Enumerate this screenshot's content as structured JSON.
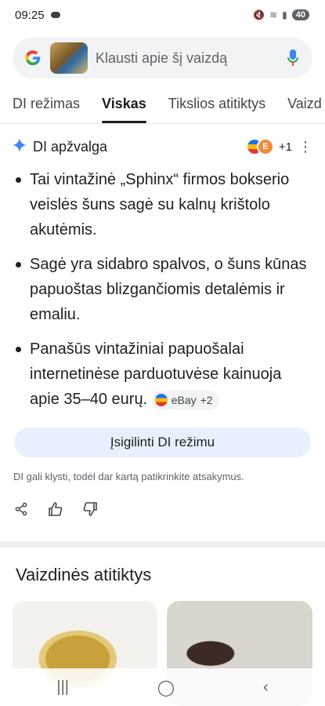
{
  "status": {
    "time": "09:25",
    "battery": "40"
  },
  "search": {
    "placeholder": "Klausti apie šį vaizdą"
  },
  "tabs": [
    {
      "label": "DI režimas"
    },
    {
      "label": "Viskas"
    },
    {
      "label": "Tikslios atitiktys"
    },
    {
      "label": "Vaizd"
    }
  ],
  "ai_overview": {
    "title": "DI apžvalga",
    "source_count": "+1",
    "bullets": [
      "Tai vintažinė „Sphinx“ firmos bokserio veislės šuns sagė su kalnų krištolo akutėmis.",
      "Sagė yra sidabro spalvos, o šuns kūnas papuoštas blizgančiomis detalėmis ir emaliu.",
      "Panašūs vintažiniai papuošalai internetinėse parduotuvėse kainuoja apie 35–40 eurų."
    ],
    "chip": {
      "label": "eBay",
      "extra": "+2"
    },
    "deep_dive_button": "Įsigilinti DI režimu",
    "disclaimer": "DI gali klysti, todėl dar kartą patikrinkite atsakymus."
  },
  "visual_matches": {
    "title": "Vaizdinės atitiktys"
  },
  "icons": {
    "google": "google-logo",
    "mic": "mic-icon",
    "sparkle": "sparkle-icon",
    "share": "share-icon",
    "thumbs_up": "thumbs-up-icon",
    "thumbs_down": "thumbs-down-icon"
  },
  "colors": {
    "accent": "#1a73e8",
    "deep_button_bg": "#e8f0fe",
    "search_bg": "#f1f3f4"
  }
}
